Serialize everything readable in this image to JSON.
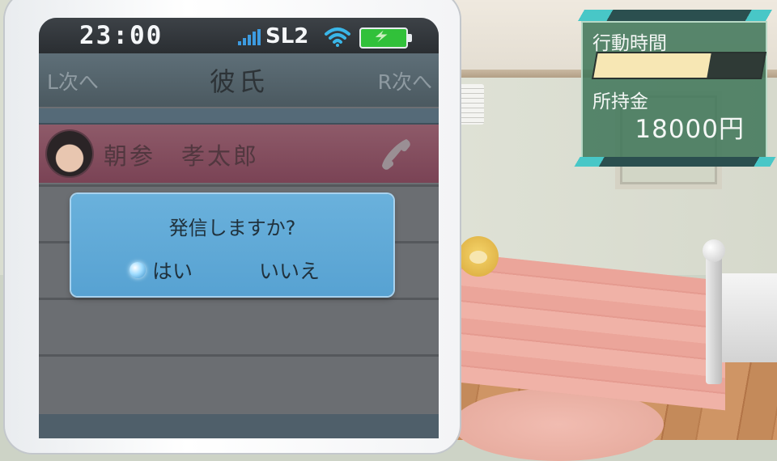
{
  "status_bar": {
    "time": "23:00",
    "carrier": "SL2",
    "signal_icon": "signal-bars-icon",
    "wifi_icon": "wifi-icon",
    "battery_icon": "battery-full-icon"
  },
  "nav": {
    "prev_label": "L次へ",
    "title": "彼氏",
    "next_label": "R次へ"
  },
  "contact": {
    "name": "朝参　孝太郎",
    "avatar_icon": "avatar-icon",
    "call_icon": "phone-handset-icon"
  },
  "dialog": {
    "question": "発信しますか?",
    "yes_label": "はい",
    "no_label": "いいえ",
    "selected": "yes"
  },
  "hud": {
    "action_time_label": "行動時間",
    "action_time_fraction": 0.68,
    "money_label": "所持金",
    "money_value": "18000円"
  },
  "colors": {
    "dialog": "#5fa9d6",
    "contact_row": "#84505f",
    "hud_panel": "#3f7658",
    "hud_accent": "#48c7c7",
    "time_bar_fill": "#f7e7b4",
    "battery": "#31c13a",
    "signal": "#3d9be0"
  }
}
